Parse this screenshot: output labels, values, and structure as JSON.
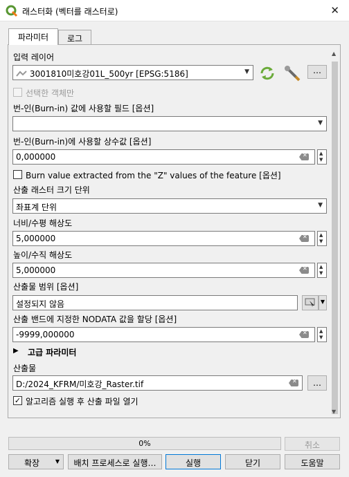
{
  "window": {
    "title": "래스터화 (벡터를 래스터로)",
    "close_glyph": "✕"
  },
  "tabs": [
    {
      "label": "파라미터"
    },
    {
      "label": "로그"
    }
  ],
  "input_layer": {
    "label": "입력 레이어",
    "value": "3001810미호강01L_500yr [EPSG:5186]",
    "more_label": "…"
  },
  "selected_only": {
    "label": "선택한 객체만"
  },
  "burn_field": {
    "label": "번-인(Burn-in) 값에 사용할 필드 [옵션]",
    "value": ""
  },
  "burn_constant": {
    "label": "번-인(Burn-in)에 사용할 상수값 [옵션]",
    "value": "0,000000"
  },
  "burn_z": {
    "label": "Burn value extracted from the \"Z\" values of the feature [옵션]"
  },
  "size_units": {
    "label": "산출 래스터 크기 단위",
    "value": "좌표계 단위"
  },
  "width": {
    "label": "너비/수평 해상도",
    "value": "5,000000"
  },
  "height": {
    "label": "높이/수직 해상도",
    "value": "5,000000"
  },
  "extent": {
    "label": "산출물 범위 [옵션]",
    "value": "설정되지 않음"
  },
  "nodata": {
    "label": "산출 밴드에 지정한 NODATA 값을 할당 [옵션]",
    "value": "-9999,000000"
  },
  "advanced": {
    "label": "고급 파라미터"
  },
  "output": {
    "label": "산출물",
    "value": "D:/2024_KFRM/미호강_Raster.tif",
    "more_label": "…"
  },
  "open_after": {
    "label": "알고리즘 실행 후 산출 파일 열기",
    "check_glyph": "✓"
  },
  "progress": {
    "text": "0%",
    "value": 0
  },
  "buttons": {
    "cancel": "취소",
    "expand": "확장",
    "batch": "배치 프로세스로 실행…",
    "run": "실행",
    "close": "닫기",
    "help": "도움말"
  },
  "colors": {
    "qgis_green": "#589632",
    "qgis_yellow": "#ee7913",
    "focus": "#0078d7"
  }
}
